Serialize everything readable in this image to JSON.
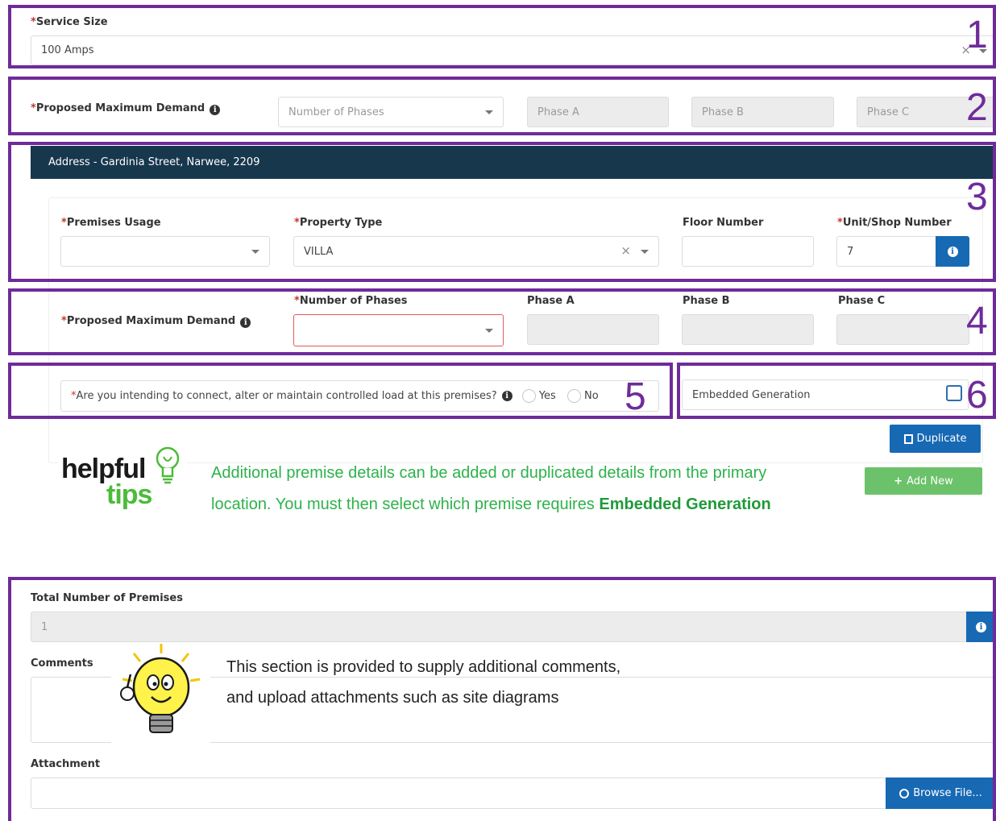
{
  "section1": {
    "service_size_label": "Service Size",
    "service_size_value": "100 Amps",
    "clear_symbol": "×"
  },
  "section2": {
    "pmd_label": "Proposed Maximum Demand",
    "phases_placeholder": "Number of Phases",
    "phase_a": "Phase A",
    "phase_b": "Phase B",
    "phase_c": "Phase C"
  },
  "address": {
    "header": "Address - Gardinia Street, Narwee, 2209",
    "premises_usage_label": "Premises Usage",
    "property_type_label": "Property Type",
    "property_type_value": "VILLA",
    "floor_number_label": "Floor Number",
    "unit_shop_label": "Unit/Shop Number",
    "unit_shop_value": "7",
    "clear_symbol": "×",
    "pmd_label": "Proposed Maximum Demand",
    "number_of_phases_label": "Number of Phases",
    "phase_a_label": "Phase A",
    "phase_b_label": "Phase B",
    "phase_c_label": "Phase C",
    "controlled_load_question": "Are you intending to connect, alter or maintain controlled load at this premises?",
    "yes_label": "Yes",
    "no_label": "No",
    "embedded_generation_label": "Embedded Generation"
  },
  "buttons": {
    "duplicate": "Duplicate",
    "add_new": "Add New",
    "browse_file": "Browse File..."
  },
  "tips": {
    "helpful_word": "helpful",
    "tips_word": "tips",
    "line1": "Additional premise details can be added or duplicated details from the primary",
    "line2_prefix": "location. You must then select which premise requires ",
    "line2_bold": "Embedded Generation",
    "comment_note_line1": "This section is provided to supply additional comments,",
    "comment_note_line2": "and upload attachments such as site diagrams"
  },
  "totals": {
    "total_premises_label": "Total Number of Premises",
    "total_premises_value": "1",
    "comments_label": "Comments",
    "attachment_label": "Attachment"
  },
  "annotations": {
    "n1": "1",
    "n2": "2",
    "n3": "3",
    "n4": "4",
    "n5": "5",
    "n6": "6"
  },
  "colors": {
    "annotation_purple": "#6f2b9a",
    "header_navy": "#17374d",
    "primary_blue": "#1769b4",
    "success_green": "#6cc26a",
    "tip_green": "#2db24a"
  },
  "icons": {
    "info": "info-circle-icon",
    "dropdown": "chevron-down-icon",
    "duplicate": "copy-icon",
    "add": "plus-icon",
    "upload": "upload-icon",
    "lightbulb": "lightbulb-icon"
  }
}
